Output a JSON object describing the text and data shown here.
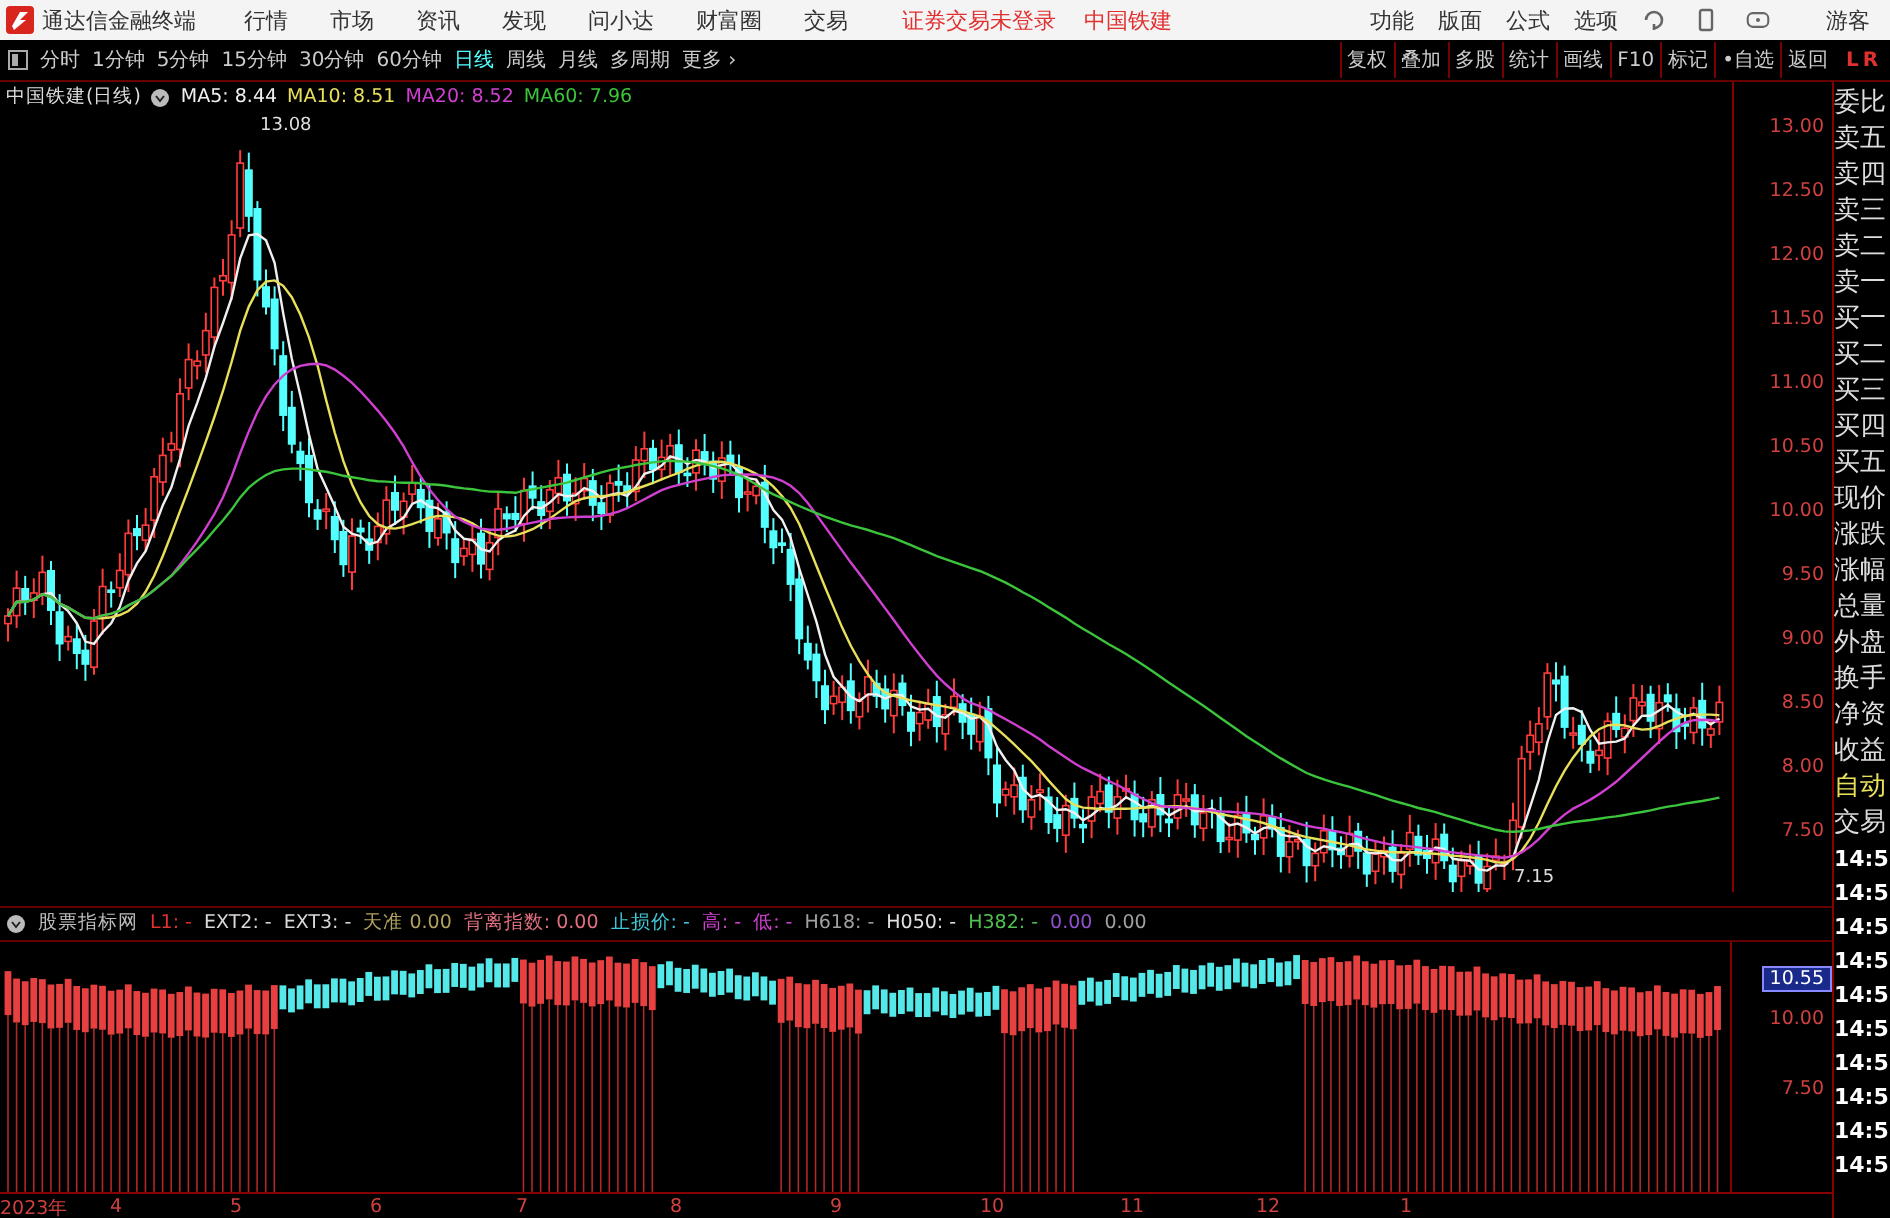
{
  "menu_bar": {
    "app_name": "通达信金融终端",
    "menus": [
      "行情",
      "市场",
      "资讯",
      "发现",
      "问小达",
      "财富圈",
      "交易"
    ],
    "status": [
      "证券交易未登录",
      "中国铁建"
    ],
    "right_menus": [
      "功能",
      "版面",
      "公式",
      "选项"
    ],
    "user": "游客"
  },
  "toolbar": {
    "periods": [
      {
        "label": "分时",
        "selected": false
      },
      {
        "label": "1分钟",
        "selected": false
      },
      {
        "label": "5分钟",
        "selected": false
      },
      {
        "label": "15分钟",
        "selected": false
      },
      {
        "label": "30分钟",
        "selected": false
      },
      {
        "label": "60分钟",
        "selected": false
      },
      {
        "label": "日线",
        "selected": true
      },
      {
        "label": "周线",
        "selected": false
      },
      {
        "label": "月线",
        "selected": false
      },
      {
        "label": "多周期",
        "selected": false
      }
    ],
    "more": "更多 ›",
    "buttons": [
      "复权",
      "叠加",
      "多股",
      "统计",
      "画线",
      "F10",
      "标记",
      "•自选",
      "返回"
    ],
    "corner": [
      "L",
      "R"
    ]
  },
  "chart": {
    "title": "中国铁建(日线)",
    "averages": [
      {
        "label": "MA5: 8.44",
        "color": "#f0f0f0"
      },
      {
        "label": "MA10: 8.51",
        "color": "#e8e05a"
      },
      {
        "label": "MA20: 8.52",
        "color": "#d040d0"
      },
      {
        "label": "MA60: 7.96",
        "color": "#3cc43c"
      }
    ],
    "high_label": "13.08",
    "low_label": "7.15",
    "price_ticks": [
      "13.00",
      "12.50",
      "12.00",
      "11.50",
      "11.00",
      "10.50",
      "10.00",
      "9.50",
      "9.00",
      "8.50",
      "8.00",
      "7.50"
    ]
  },
  "indicator": {
    "name": "股票指标网",
    "fields": [
      {
        "text": "L1: -",
        "color": "#e03030"
      },
      {
        "text": "EXT2: -",
        "color": "#d8d8d8"
      },
      {
        "text": "EXT3: -",
        "color": "#d8d8d8"
      },
      {
        "text": "天准 0.00",
        "color": "#b0a060"
      },
      {
        "text": "背离指数: 0.00",
        "color": "#e07080"
      },
      {
        "text": "止损价: -",
        "color": "#40c8d8"
      },
      {
        "text": "高: -",
        "color": "#d040d0"
      },
      {
        "text": "低: -",
        "color": "#d040d0"
      },
      {
        "text": "H618: -",
        "color": "#a0a0a0"
      },
      {
        "text": "H050: -",
        "color": "#e0e0e0"
      },
      {
        "text": "H382: -",
        "color": "#50c050"
      },
      {
        "text": "0.00",
        "color": "#9050d0"
      },
      {
        "text": "0.00",
        "color": "#a0a0a0"
      }
    ],
    "current_value": "10.55",
    "ticks": [
      "10.00",
      "7.50"
    ]
  },
  "x_axis": [
    "2023年",
    "4",
    "5",
    "6",
    "7",
    "8",
    "9",
    "10",
    "11",
    "12",
    "1"
  ],
  "side_panel": {
    "labels": [
      {
        "text": "委比",
        "kind": "normal"
      },
      {
        "text": "卖五",
        "kind": "normal"
      },
      {
        "text": "卖四",
        "kind": "normal"
      },
      {
        "text": "卖三",
        "kind": "normal"
      },
      {
        "text": "卖二",
        "kind": "normal"
      },
      {
        "text": "卖一",
        "kind": "normal"
      },
      {
        "text": "买一",
        "kind": "normal"
      },
      {
        "text": "买二",
        "kind": "normal"
      },
      {
        "text": "买三",
        "kind": "normal"
      },
      {
        "text": "买四",
        "kind": "normal"
      },
      {
        "text": "买五",
        "kind": "normal"
      },
      {
        "text": "现价",
        "kind": "normal"
      },
      {
        "text": "涨跌",
        "kind": "normal"
      },
      {
        "text": "涨幅",
        "kind": "normal"
      },
      {
        "text": "总量",
        "kind": "normal"
      },
      {
        "text": "外盘",
        "kind": "normal"
      },
      {
        "text": "换手",
        "kind": "normal"
      },
      {
        "text": "净资",
        "kind": "normal"
      },
      {
        "text": "收益",
        "kind": "normal"
      },
      {
        "text": "自动",
        "kind": "highlight"
      },
      {
        "text": "交易",
        "kind": "normal"
      }
    ],
    "times": [
      "14:5",
      "14:5",
      "14:5",
      "14:5",
      "14:5",
      "14:5",
      "14:5",
      "14:5",
      "14:5",
      "14:5"
    ]
  }
}
